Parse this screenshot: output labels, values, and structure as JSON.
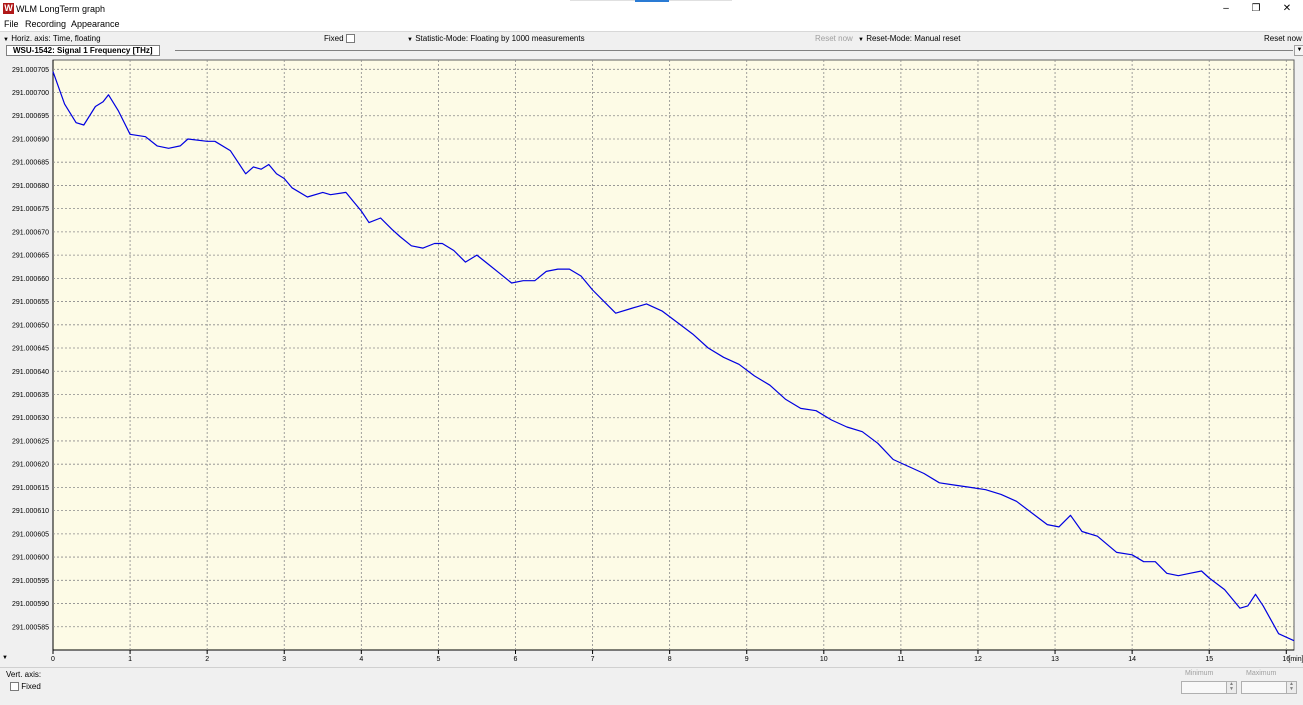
{
  "window": {
    "title": "WLM LongTerm graph",
    "icon_text": "W"
  },
  "menu": {
    "items": [
      "File",
      "Recording",
      "Appearance"
    ]
  },
  "toolbar": {
    "horiz_axis": "Horiz. axis: Time, floating",
    "fixed_label": "Fixed",
    "statistic_mode": "Statistic-Mode: Floating by 1000 measurements",
    "reset_now_disabled": "Reset now",
    "reset_mode": "Reset-Mode: Manual reset",
    "reset_now": "Reset now"
  },
  "bottom": {
    "vert_axis": "Vert. axis:",
    "fixed_label": "Fixed",
    "minimum_label": "Minimum",
    "maximum_label": "Maximum"
  },
  "chart_data": {
    "type": "line",
    "title": "WSU-1542: Signal 1  Frequency  [THz]",
    "xlabel": "[min]",
    "ylabel": "",
    "xlim": [
      0,
      16.1
    ],
    "ylim": [
      291.00058,
      291.000707
    ],
    "grid": true,
    "x_ticks": [
      0,
      1,
      2,
      3,
      4,
      5,
      6,
      7,
      8,
      9,
      10,
      11,
      12,
      13,
      14,
      15,
      16
    ],
    "y_ticks": [
      "291.000705",
      "291.000700",
      "291.000695",
      "291.000690",
      "291.000685",
      "291.000680",
      "291.000675",
      "291.000670",
      "291.000665",
      "291.000660",
      "291.000655",
      "291.000650",
      "291.000645",
      "291.000640",
      "291.000635",
      "291.000630",
      "291.000625",
      "291.000620",
      "291.000615",
      "291.000610",
      "291.000605",
      "291.000600",
      "291.000595",
      "291.000590",
      "291.000585"
    ],
    "line_color": "#0000e0",
    "background": "#fdfbe6",
    "series": [
      {
        "x": [
          0,
          0.15,
          0.3,
          0.4,
          0.55,
          0.65,
          0.72,
          0.85,
          1.0,
          1.2,
          1.35,
          1.5,
          1.65,
          1.75,
          2.0,
          2.1,
          2.3,
          2.5,
          2.6,
          2.7,
          2.8,
          2.9,
          3.0,
          3.1,
          3.3,
          3.5,
          3.6,
          3.8,
          3.9,
          4.0,
          4.1,
          4.25,
          4.4,
          4.5,
          4.65,
          4.8,
          4.95,
          5.05,
          5.2,
          5.35,
          5.5,
          5.65,
          5.8,
          5.95,
          6.1,
          6.25,
          6.4,
          6.55,
          6.7,
          6.85,
          7.0,
          7.15,
          7.3,
          7.5,
          7.7,
          7.9,
          8.1,
          8.3,
          8.5,
          8.7,
          8.9,
          9.1,
          9.3,
          9.5,
          9.7,
          9.9,
          10.1,
          10.3,
          10.5,
          10.7,
          10.9,
          11.1,
          11.3,
          11.5,
          11.7,
          11.9,
          12.1,
          12.3,
          12.5,
          12.7,
          12.9,
          13.05,
          13.2,
          13.35,
          13.55,
          13.8,
          14.0,
          14.15,
          14.3,
          14.45,
          14.6,
          14.75,
          14.9,
          15.0,
          15.2,
          15.4,
          15.5,
          15.6,
          15.7,
          15.8,
          15.9,
          16.1
        ],
        "y": [
          291.0007045,
          291.0006975,
          291.0006935,
          291.000693,
          291.000697,
          291.000698,
          291.0006995,
          291.000696,
          291.000691,
          291.0006905,
          291.0006885,
          291.000688,
          291.0006885,
          291.00069,
          291.0006895,
          291.0006895,
          291.0006875,
          291.0006825,
          291.000684,
          291.0006835,
          291.0006845,
          291.0006825,
          291.0006815,
          291.0006795,
          291.0006775,
          291.0006785,
          291.000678,
          291.0006785,
          291.0006765,
          291.0006745,
          291.000672,
          291.000673,
          291.0006705,
          291.000669,
          291.000667,
          291.0006665,
          291.0006675,
          291.0006675,
          291.000666,
          291.0006635,
          291.000665,
          291.000663,
          291.000661,
          291.000659,
          291.0006595,
          291.0006595,
          291.0006615,
          291.000662,
          291.000662,
          291.0006605,
          291.0006575,
          291.000655,
          291.0006525,
          291.0006535,
          291.0006545,
          291.000653,
          291.0006505,
          291.000648,
          291.000645,
          291.000643,
          291.0006415,
          291.000639,
          291.000637,
          291.000634,
          291.000632,
          291.0006315,
          291.0006295,
          291.000628,
          291.000627,
          291.0006245,
          291.000621,
          291.0006195,
          291.000618,
          291.000616,
          291.0006155,
          291.000615,
          291.0006145,
          291.0006135,
          291.000612,
          291.0006095,
          291.000607,
          291.0006065,
          291.000609,
          291.0006055,
          291.0006045,
          291.000601,
          291.0006005,
          291.000599,
          291.000599,
          291.0005965,
          291.000596,
          291.0005965,
          291.000597,
          291.0005955,
          291.000593,
          291.000589,
          291.0005895,
          291.000592,
          291.0005895,
          291.0005865,
          291.0005835,
          291.000582
        ]
      }
    ]
  }
}
